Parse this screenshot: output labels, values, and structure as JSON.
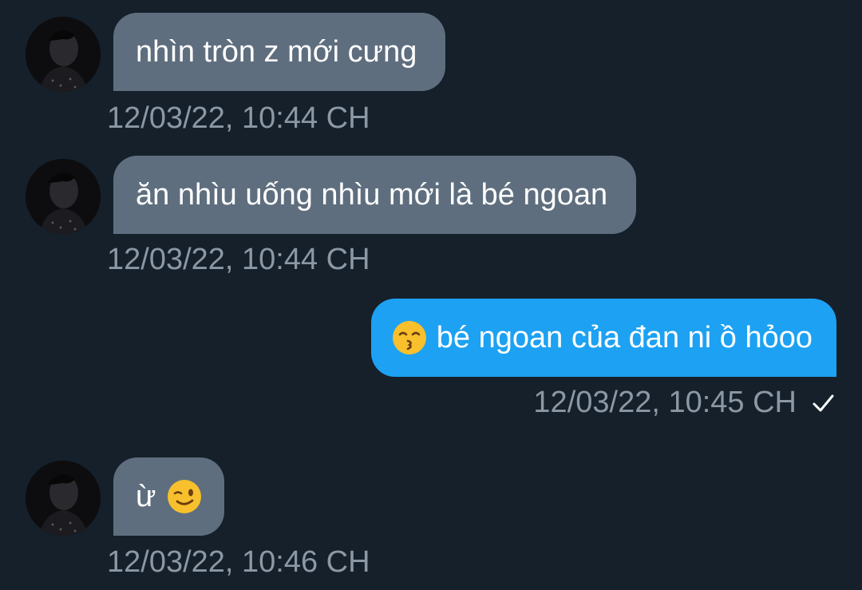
{
  "messages": [
    {
      "direction": "in",
      "text": "nhìn tròn z mới cưng",
      "timestamp": "12/03/22, 10:44 CH"
    },
    {
      "direction": "in",
      "text": "ăn nhìu uống nhìu mới là bé ngoan",
      "timestamp": "12/03/22, 10:44 CH"
    },
    {
      "direction": "out",
      "emoji": "kissing-face-with-smiling-eyes",
      "text": "bé ngoan của đan ni ồ hỏoo",
      "timestamp": "12/03/22, 10:45 CH",
      "status": "sent-check"
    },
    {
      "direction": "in",
      "text": "ừ",
      "emoji": "winking-face",
      "timestamp": "12/03/22, 10:46 CH"
    }
  ],
  "colors": {
    "background": "#15202b",
    "incoming_bubble": "#5e6e7e",
    "outgoing_bubble": "#1da1f2",
    "timestamp": "#8b98a5"
  }
}
